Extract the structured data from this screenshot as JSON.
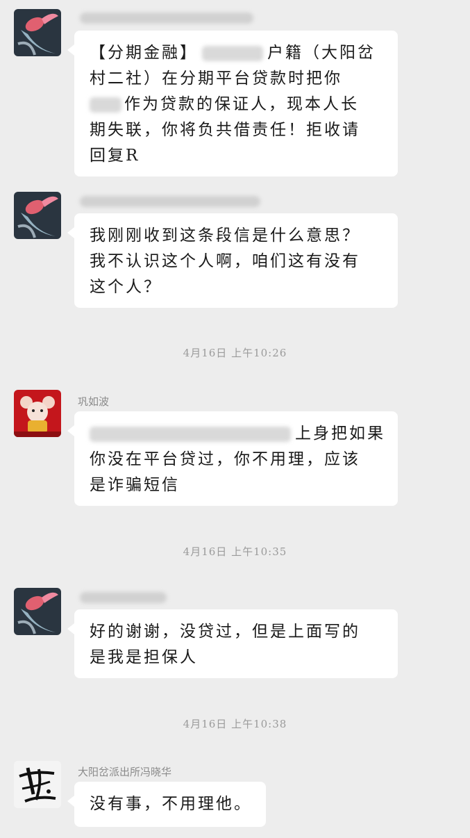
{
  "messages": [
    {
      "sender": "",
      "lines": [
        "【分期金融】",
        "户籍（大阳岔",
        "村二社）在分期平台贷款时把你",
        "作为贷款的保证人，现本人长",
        "期失联，你将负共借责任！拒收请",
        "回复R"
      ]
    },
    {
      "sender": "",
      "lines": [
        "我刚刚收到这条段信是什么意思？",
        "我不认识这个人啊，咱们这有没有",
        "这个人？"
      ]
    },
    {
      "sender": "巩如波",
      "lines": [
        "上身把如果",
        "你没在平台贷过，你不用理，应该",
        "是诈骗短信"
      ]
    },
    {
      "sender": "",
      "lines": [
        "好的谢谢，没贷过，但是上面写的",
        "是我是担保人"
      ]
    },
    {
      "sender": "大阳岔派出所冯晓华",
      "lines": [
        "没有事，不用理他。"
      ]
    }
  ],
  "timestamps": [
    "4月16日 上午10:26",
    "4月16日 上午10:35",
    "4月16日 上午10:38"
  ],
  "colors": {
    "background": "#ededed",
    "bubble": "#ffffff",
    "meta_text": "#9a9a9a"
  },
  "avatars": [
    "koi-fish-avatar",
    "koi-fish-avatar",
    "mouse-new-year-avatar",
    "koi-fish-avatar",
    "calligraphy-avatar"
  ]
}
